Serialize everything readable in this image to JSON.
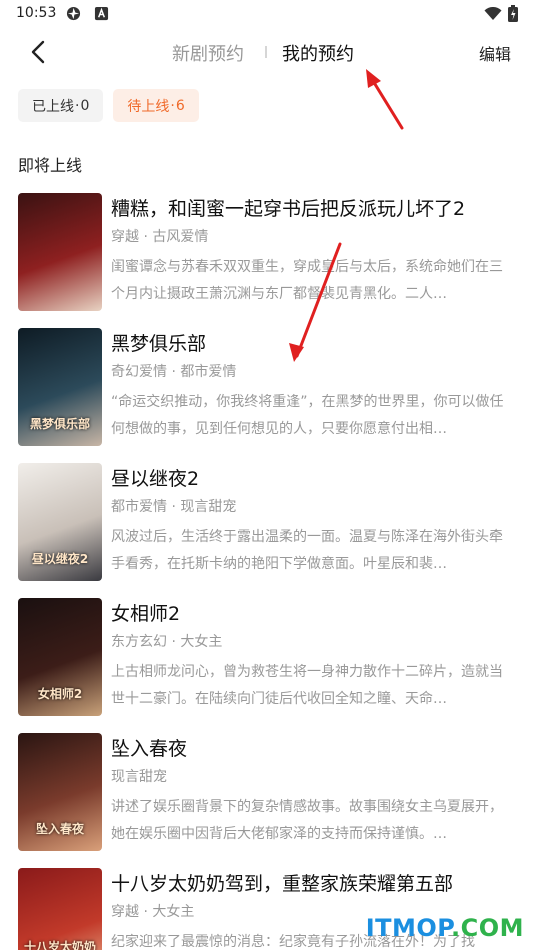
{
  "status_bar": {
    "time": "10:53"
  },
  "nav": {
    "tab_new": "新剧预约",
    "tab_mine": "我的预约",
    "edit": "编辑"
  },
  "filters": {
    "online": {
      "label": "已上线",
      "dot": "·",
      "count": "0"
    },
    "pending": {
      "label": "待上线",
      "dot": "·",
      "count": "6"
    }
  },
  "section_title": "即将上线",
  "items": [
    {
      "title": "糟糕，和闺蜜一起穿书后把反派玩儿坏了2",
      "tags": "穿越 · 古风爱情",
      "desc": "闺蜜谭念与苏春禾双双重生，穿成皇后与太后，系统命她们在三个月内让摄政王萧沉渊与东厂都督裴见青黑化。二人…",
      "cover_text": "",
      "cover_colors": [
        "#3a1212",
        "#8e2020",
        "#e8d3c3"
      ]
    },
    {
      "title": "黑梦俱乐部",
      "tags": "奇幻爱情 · 都市爱情",
      "desc": "“命运交织推动，你我终将重逢”，在黑梦的世界里，你可以做任何想做的事，见到任何想见的人，只要你愿意付出相…",
      "cover_text": "黑梦俱乐部",
      "cover_colors": [
        "#0e1b24",
        "#2c4a5a",
        "#c8b6a6"
      ]
    },
    {
      "title": "昼以继夜2",
      "tags": "都市爱情 · 现言甜宠",
      "desc": "风波过后，生活终于露出温柔的一面。温夏与陈泽在海外街头牵手看秀，在托斯卡纳的艳阳下学做意面。叶星辰和裴…",
      "cover_text": "昼以继夜2",
      "cover_colors": [
        "#f1eeea",
        "#c9c0b8",
        "#3a3a40"
      ]
    },
    {
      "title": "女相师2",
      "tags": "东方玄幻 · 大女主",
      "desc": "上古相师龙问心，曾为救苍生将一身神力散作十二碎片，造就当世十二豪门。在陆续向门徒后代收回全知之瞳、天命…",
      "cover_text": "女相师2",
      "cover_colors": [
        "#1a1010",
        "#3c1d18",
        "#c9a27a"
      ]
    },
    {
      "title": "坠入春夜",
      "tags": "现言甜宠",
      "desc": "讲述了娱乐圈背景下的复杂情感故事。故事围绕女主乌夏展开，她在娱乐圈中因背后大佬郁家泽的支持而保持谨慎。…",
      "cover_text": "坠入春夜",
      "cover_colors": [
        "#2a1512",
        "#7a3b2c",
        "#d9a07a"
      ]
    },
    {
      "title": "十八岁太奶奶驾到，重整家族荣耀第五部",
      "tags": "穿越 · 大女主",
      "desc": "纪家迎来了最震惊的消息：纪家竟有子孙流落在外！为了找",
      "cover_text": "十八岁太奶奶驾到",
      "cover_colors": [
        "#8a1a1a",
        "#c23a2a",
        "#f0c8a0"
      ]
    }
  ],
  "watermark": {
    "part1": "ITMOP",
    "part2": ".COM"
  },
  "colors": {
    "accent": "#f06a2a",
    "accent_bg": "#fdeee6",
    "annotation_arrow": "#e02020",
    "watermark_blue": "#1b8fe0",
    "watermark_green": "#2fb24c"
  }
}
